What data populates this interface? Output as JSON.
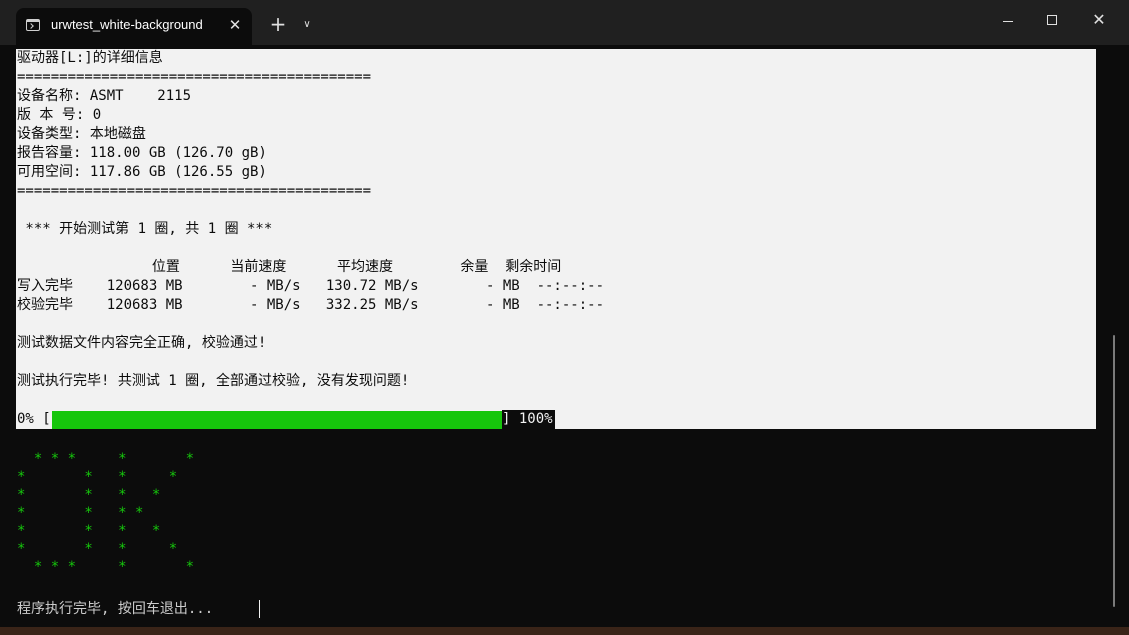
{
  "window": {
    "tab_title": "urwtest_white-background",
    "close_tab_glyph": "✕",
    "new_tab_glyph": "+",
    "dropdown_glyph": "∨",
    "close_window_glyph": "✕"
  },
  "icons": {
    "tab": "terminal-icon",
    "min": "minimize-icon",
    "max": "maximize-icon",
    "close": "close-icon"
  },
  "colors": {
    "panel_background": "#f2f2f2",
    "terminal_background": "#0c0c0c",
    "progress_fill": "#16c60c",
    "ascii_art": "#16c60c"
  },
  "terminal": {
    "header": "驱动器[L:]的详细信息",
    "separator": "==========================================",
    "device_name": "设备名称: ASMT    2115",
    "version": "版 本 号: 0",
    "device_type": "设备类型: 本地磁盘",
    "reported_capacity": "报告容量: 118.00 GB (126.70 gB)",
    "free_space": "可用空间: 117.86 GB (126.55 gB)",
    "separator2": "==========================================",
    "round_banner": " *** 开始测试第 1 圈, 共 1 圈 ***",
    "table_header": "                位置      当前速度      平均速度        余量  剩余时间",
    "table_rows": [
      "写入完毕    120683 MB        - MB/s   130.72 MB/s        - MB  --:--:--",
      "校验完毕    120683 MB        - MB/s   332.25 MB/s        - MB  --:--:--"
    ],
    "verify_message": "测试数据文件内容完全正确, 校验通过!",
    "complete_message": "测试执行完毕! 共测试 1 圈, 全部通过校验, 没有发现问题!",
    "progress": {
      "start_label": "0% [",
      "end_label": "] 100%",
      "value": 100
    },
    "ascii_art": [
      "  * * *     *       *",
      "*       *   *     *",
      "*       *   *   *",
      "*       *   * *",
      "*       *   *   *",
      "*       *   *     *",
      "  * * *     *       *"
    ],
    "prompt": "程序执行完毕, 按回车退出..."
  }
}
